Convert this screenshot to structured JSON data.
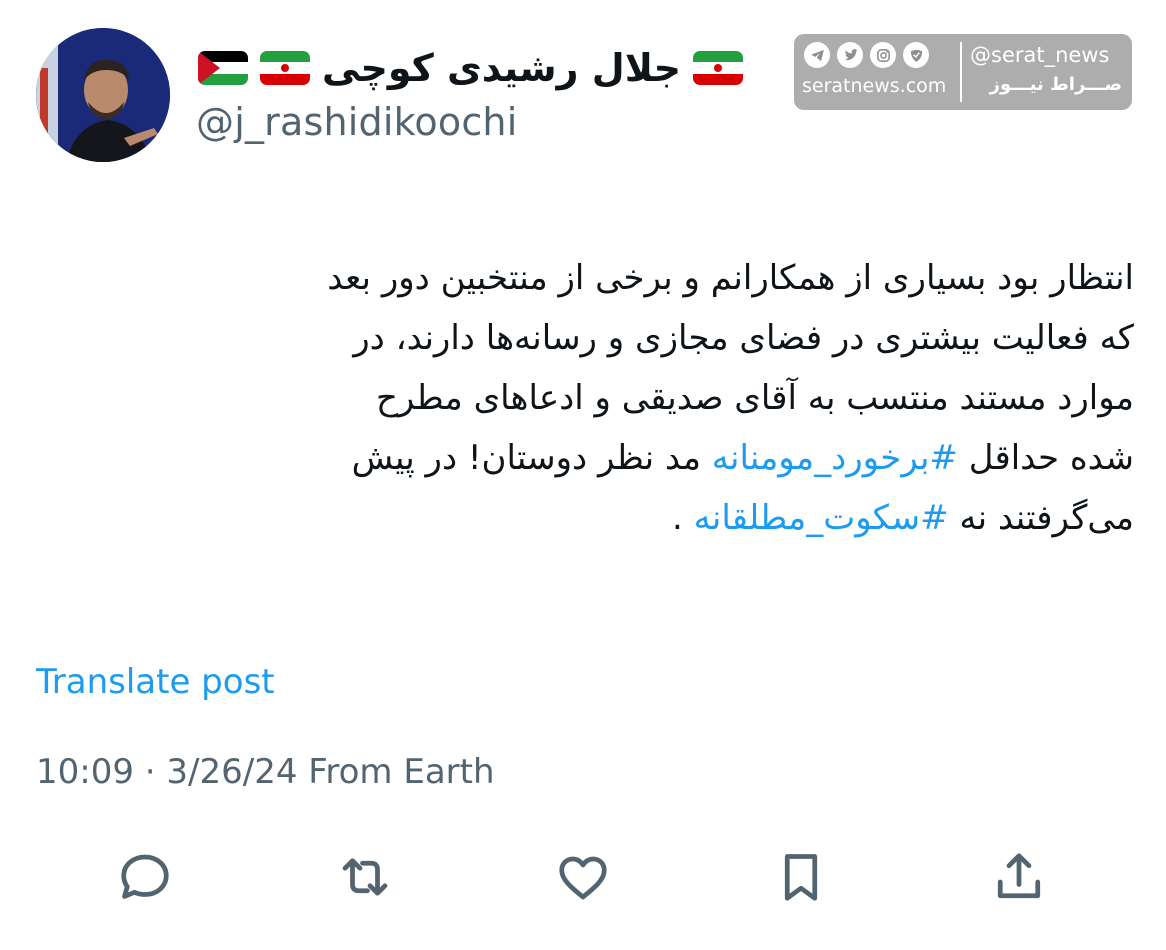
{
  "author": {
    "display_name": "جلال رشیدی کوچی",
    "handle": "@j_rashidikoochi",
    "name_flags": [
      "palestine-flag",
      "iran-flag",
      "iran-flag"
    ]
  },
  "watermark": {
    "handle": "@serat_news",
    "brand": "صـــراط نیـــوز",
    "domain": "seratnews.com",
    "icons": [
      "telegram-icon",
      "twitter-icon",
      "instagram-icon",
      "soroush-icon"
    ]
  },
  "post": {
    "line1": "انتظار بود بسیاری از همکارانم و برخی از منتخبین دور بعد",
    "line2": "که فعالیت بیشتری در فضای مجازی و رسانه‌ها دارند، در",
    "line3": "موارد مستند منتسب به آقای صدیقی و ادعاهای مطرح",
    "line4_start": "شده حداقل ",
    "hashtag1": "#برخورد_مومنانه",
    "line4_end": " مد نظر دوستان! در پیش",
    "line5_start": "می‌گرفتند نه ",
    "hashtag2": "#سکوت_مطلقانه",
    "line5_end": " ."
  },
  "translate_label": "Translate post",
  "meta": {
    "time": "10:09",
    "separator": " · ",
    "date": "3/26/24",
    "source": " From Earth"
  },
  "actions": [
    "reply-icon",
    "repost-icon",
    "like-icon",
    "bookmark-icon",
    "share-icon"
  ],
  "colors": {
    "link": "#1d9bf0",
    "secondary_text": "#536471",
    "primary_text": "#0f1419"
  }
}
